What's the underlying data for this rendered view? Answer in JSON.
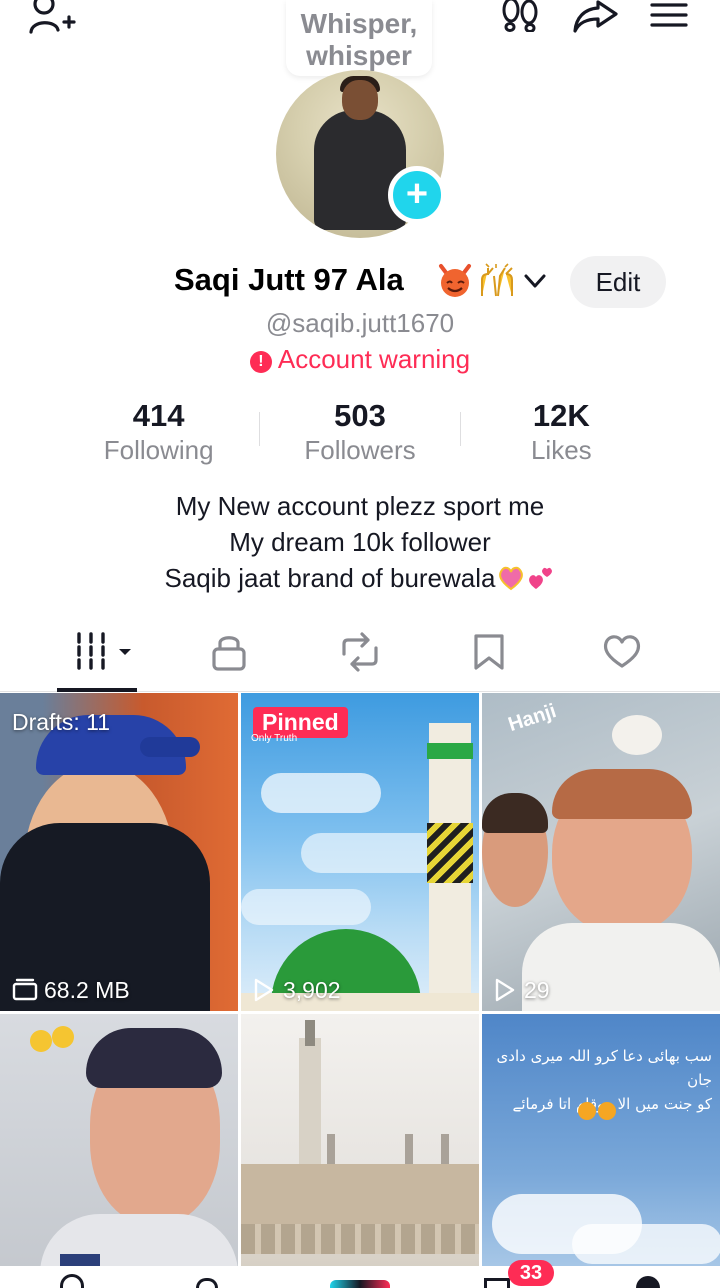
{
  "header": {
    "add_friend_icon": "person-add-icon",
    "bubble_text": "Whisper, whisper",
    "icons": [
      "footprints-icon",
      "share-icon",
      "menu-icon"
    ]
  },
  "profile": {
    "name": "Saqi Jutt 97 Ala",
    "name_emojis": [
      "smiling-devil-emoji",
      "raised-hands-emoji"
    ],
    "handle": "@saqib.jutt1670",
    "edit_label": "Edit",
    "warning": "Account warning",
    "stats": [
      {
        "value": "414",
        "label": "Following"
      },
      {
        "value": "503",
        "label": "Followers"
      },
      {
        "value": "12K",
        "label": "Likes"
      }
    ],
    "bio_lines": [
      "My New account plezz sport me",
      "My dream 10k follower",
      "Saqib jaat brand of burewala"
    ]
  },
  "tabs": [
    {
      "name": "videos",
      "icon": "grid-icon",
      "active": true
    },
    {
      "name": "private",
      "icon": "lock-icon",
      "active": false
    },
    {
      "name": "reposts",
      "icon": "repost-icon",
      "active": false
    },
    {
      "name": "favorites",
      "icon": "bookmark-icon",
      "active": false
    },
    {
      "name": "liked",
      "icon": "heart-icon",
      "active": false
    }
  ],
  "grid": [
    {
      "label": "Drafts: 11",
      "footer": "68.2 MB",
      "footer_icon": "drafts-icon"
    },
    {
      "pinned": "Pinned",
      "caption": "Only Truth",
      "footer": "3,902",
      "footer_icon": "play-icon"
    },
    {
      "caption": "Hanji",
      "footer": "29",
      "footer_icon": "play-icon"
    },
    {
      "caption": ""
    },
    {
      "caption": ""
    },
    {
      "urdu_line1": "سب بھائی دعا کرو اللہ میری دادی جان",
      "urdu_line2": "کو جنت میں الا موقام اتا فرمائے"
    }
  ],
  "bottom_nav": {
    "inbox_badge": "33"
  },
  "colors": {
    "accent": "#fe2c55",
    "plus": "#20d5ec",
    "secondary_text": "#8a8b91"
  }
}
